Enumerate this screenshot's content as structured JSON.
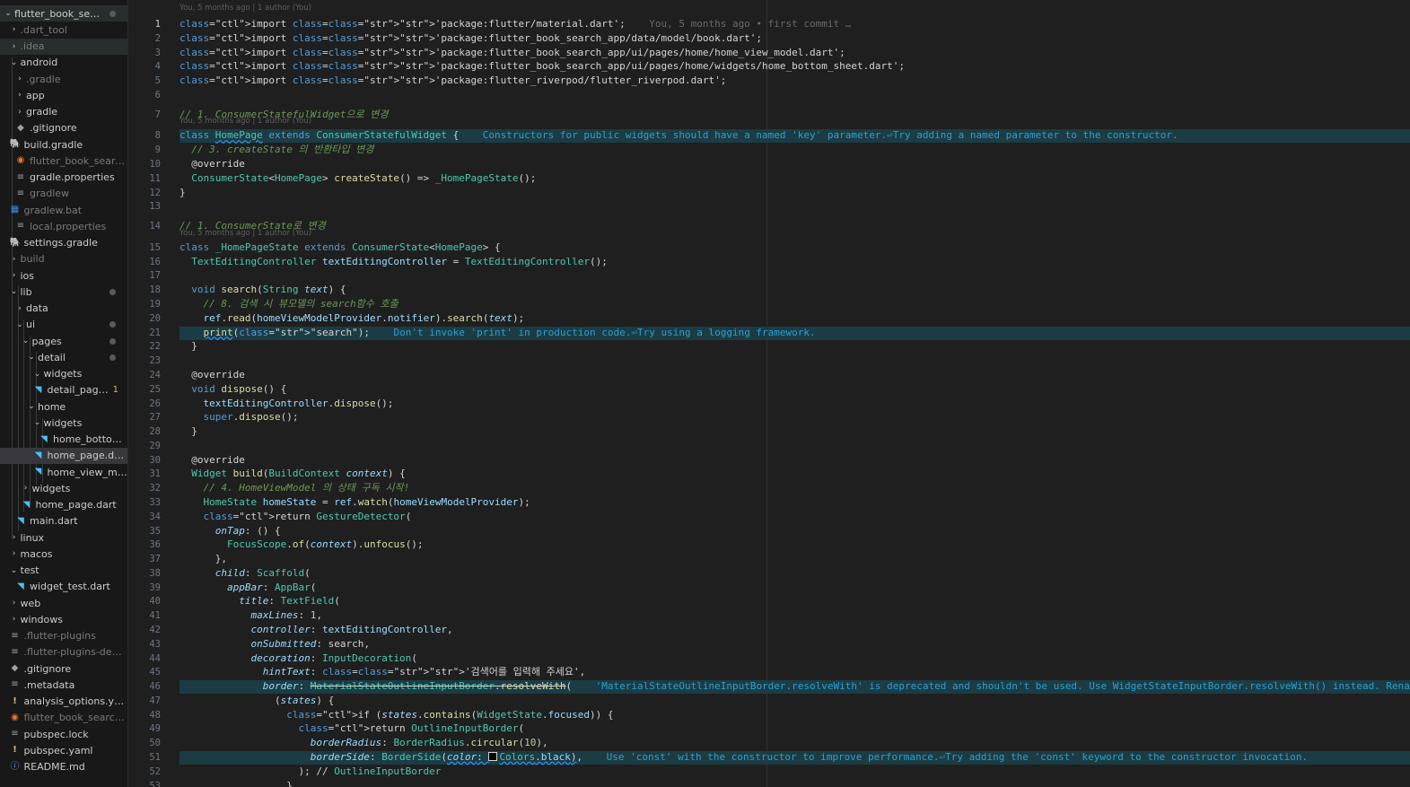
{
  "explorer": {
    "items": [
      {
        "label": "flutter_book_sear...",
        "depth": 0,
        "chev": "v",
        "icon": "",
        "dot": true,
        "hov": true
      },
      {
        "label": ".dart_tool",
        "depth": 1,
        "chev": ">",
        "icon": "",
        "dim": true
      },
      {
        "label": ".idea",
        "depth": 1,
        "chev": ">",
        "icon": "",
        "dim": true,
        "hov": true
      },
      {
        "label": "android",
        "depth": 1,
        "chev": "v",
        "icon": ""
      },
      {
        "label": ".gradle",
        "depth": 2,
        "chev": ">",
        "icon": "",
        "dim": true
      },
      {
        "label": "app",
        "depth": 2,
        "chev": ">",
        "icon": ""
      },
      {
        "label": "gradle",
        "depth": 2,
        "chev": ">",
        "icon": ""
      },
      {
        "label": ".gitignore",
        "depth": 2,
        "chev": "",
        "icon": "diamond"
      },
      {
        "label": "build.gradle",
        "depth": 1,
        "chev": "",
        "icon": "gradle"
      },
      {
        "label": "flutter_book_search_...",
        "depth": 2,
        "chev": "",
        "icon": "rss",
        "dim": true
      },
      {
        "label": "gradle.properties",
        "depth": 2,
        "chev": "",
        "icon": "file"
      },
      {
        "label": "gradlew",
        "depth": 2,
        "chev": "",
        "icon": "file",
        "dim": true
      },
      {
        "label": "gradlew.bat",
        "depth": 1,
        "chev": "",
        "icon": "win",
        "dim": true
      },
      {
        "label": "local.properties",
        "depth": 2,
        "chev": "",
        "icon": "file",
        "dim": true
      },
      {
        "label": "settings.gradle",
        "depth": 1,
        "chev": "",
        "icon": "gradle"
      },
      {
        "label": "build",
        "depth": 1,
        "chev": ">",
        "icon": "",
        "dim": true
      },
      {
        "label": "ios",
        "depth": 1,
        "chev": ">",
        "icon": ""
      },
      {
        "label": "lib",
        "depth": 1,
        "chev": "v",
        "icon": "",
        "dot": true
      },
      {
        "label": "data",
        "depth": 2,
        "chev": ">",
        "icon": ""
      },
      {
        "label": "ui",
        "depth": 2,
        "chev": "v",
        "icon": "",
        "dot": true
      },
      {
        "label": "pages",
        "depth": 3,
        "chev": "v",
        "icon": "",
        "dot": true
      },
      {
        "label": "detail",
        "depth": 4,
        "chev": "v",
        "icon": "",
        "dot": true
      },
      {
        "label": "widgets",
        "depth": 5,
        "chev": "v",
        "icon": ""
      },
      {
        "label": "detail_page....",
        "depth": 5,
        "chev": "",
        "icon": "dart",
        "badge": "1"
      },
      {
        "label": "home",
        "depth": 4,
        "chev": "v",
        "icon": ""
      },
      {
        "label": "widgets",
        "depth": 5,
        "chev": "v",
        "icon": ""
      },
      {
        "label": "home_bottom_...",
        "depth": 6,
        "chev": "",
        "icon": "dart"
      },
      {
        "label": "home_page.dart",
        "depth": 5,
        "chev": "",
        "icon": "dart",
        "sel": true
      },
      {
        "label": "home_view_mod...",
        "depth": 5,
        "chev": "",
        "icon": "dart"
      },
      {
        "label": "widgets",
        "depth": 3,
        "chev": ">",
        "icon": ""
      },
      {
        "label": "home_page.dart",
        "depth": 3,
        "chev": "",
        "icon": "dart"
      },
      {
        "label": "main.dart",
        "depth": 2,
        "chev": "",
        "icon": "dart"
      },
      {
        "label": "linux",
        "depth": 1,
        "chev": ">",
        "icon": ""
      },
      {
        "label": "macos",
        "depth": 1,
        "chev": ">",
        "icon": ""
      },
      {
        "label": "test",
        "depth": 1,
        "chev": "v",
        "icon": ""
      },
      {
        "label": "widget_test.dart",
        "depth": 2,
        "chev": "",
        "icon": "dart"
      },
      {
        "label": "web",
        "depth": 1,
        "chev": ">",
        "icon": ""
      },
      {
        "label": "windows",
        "depth": 1,
        "chev": ">",
        "icon": ""
      },
      {
        "label": ".flutter-plugins",
        "depth": 1,
        "chev": "",
        "icon": "file",
        "dim": true
      },
      {
        "label": ".flutter-plugins-depen...",
        "depth": 1,
        "chev": "",
        "icon": "file",
        "dim": true
      },
      {
        "label": ".gitignore",
        "depth": 1,
        "chev": "",
        "icon": "diamond"
      },
      {
        "label": ".metadata",
        "depth": 1,
        "chev": "",
        "icon": "file"
      },
      {
        "label": "analysis_options.yaml",
        "depth": 1,
        "chev": "",
        "icon": "excl"
      },
      {
        "label": "flutter_book_search_a...",
        "depth": 1,
        "chev": "",
        "icon": "rss",
        "dim": true
      },
      {
        "label": "pubspec.lock",
        "depth": 1,
        "chev": "",
        "icon": "file"
      },
      {
        "label": "pubspec.yaml",
        "depth": 1,
        "chev": "",
        "icon": "excl"
      },
      {
        "label": "README.md",
        "depth": 1,
        "chev": "",
        "icon": "info"
      }
    ]
  },
  "editor": {
    "blame_author": "You, 5 months ago | 1 author (You)",
    "inline_blame": "You, 5 months ago • first commit …",
    "hint_l8": "Constructors for public widgets should have a named 'key' parameter.⏎Try adding a named parameter to the constructor.",
    "hint_l21": "Don't invoke 'print' in production code.⏎Try using a logging framework.",
    "hint_l46": "'MaterialStateOutlineInputBorder.resolveWith' is deprecated and shouldn't be used. Use WidgetStateInputBorder.resolveWith() instead. Renamed to",
    "hint_l51": "Use 'const' with the constructor to improve performance.⏎Try adding the 'const' keyword to the constructor invocation.",
    "lines": [
      "import 'package:flutter/material.dart';",
      "import 'package:flutter_book_search_app/data/model/book.dart';",
      "import 'package:flutter_book_search_app/ui/pages/home/home_view_model.dart';",
      "import 'package:flutter_book_search_app/ui/pages/home/widgets/home_bottom_sheet.dart';",
      "import 'package:flutter_riverpod/flutter_riverpod.dart';",
      "",
      "// 1. ConsumerStatefulWidget으로 변경",
      "class HomePage extends ConsumerStatefulWidget {",
      "  // 3. createState 의 반환타입 변경",
      "  @override",
      "  ConsumerState<HomePage> createState() => _HomePageState();",
      "}",
      "",
      "// 1. ConsumerState로 변경",
      "class _HomePageState extends ConsumerState<HomePage> {",
      "  TextEditingController textEditingController = TextEditingController();",
      "",
      "  void search(String text) {",
      "    // 8. 검색 시 뷰모델의 search함수 호출",
      "    ref.read(homeViewModelProvider.notifier).search(text);",
      "    print(\"search\");",
      "  }",
      "",
      "  @override",
      "  void dispose() {",
      "    textEditingController.dispose();",
      "    super.dispose();",
      "  }",
      "",
      "  @override",
      "  Widget build(BuildContext context) {",
      "    // 4. HomeViewModel 의 상태 구독 시작!",
      "    HomeState homeState = ref.watch(homeViewModelProvider);",
      "    return GestureDetector(",
      "      onTap: () {",
      "        FocusScope.of(context).unfocus();",
      "      },",
      "      child: Scaffold(",
      "        appBar: AppBar(",
      "          title: TextField(",
      "            maxLines: 1,",
      "            controller: textEditingController,",
      "            onSubmitted: search,",
      "            decoration: InputDecoration(",
      "              hintText: '검색어를 입력해 주세요',",
      "              border: MaterialStateOutlineInputBorder.resolveWith(",
      "                (states) {",
      "                  if (states.contains(WidgetState.focused)) {",
      "                    return OutlineInputBorder(",
      "                      borderRadius: BorderRadius.circular(10),",
      "                      borderSide: BorderSide(color: Colors.black),",
      "                    ); // OutlineInputBorder",
      "                  }"
    ]
  },
  "colors": {
    "background": "#1f1f1f",
    "sidebar": "#181818",
    "selected_row": "#37373d",
    "hint_highlight": "#1b3c44",
    "hint_text": "#2f9fd0"
  }
}
